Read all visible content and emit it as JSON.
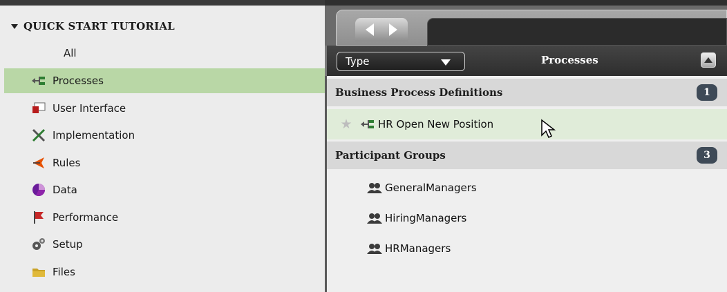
{
  "library": {
    "header": "QUICK START TUTORIAL",
    "items": [
      {
        "label": "All",
        "icon": "none",
        "selected": false
      },
      {
        "label": "Processes",
        "icon": "process-icon",
        "selected": true
      },
      {
        "label": "User Interface",
        "icon": "user-interface-icon",
        "selected": false
      },
      {
        "label": "Implementation",
        "icon": "tools-icon",
        "selected": false
      },
      {
        "label": "Rules",
        "icon": "rules-icon",
        "selected": false
      },
      {
        "label": "Data",
        "icon": "data-icon",
        "selected": false
      },
      {
        "label": "Performance",
        "icon": "flag-icon",
        "selected": false
      },
      {
        "label": "Setup",
        "icon": "gears-icon",
        "selected": false
      },
      {
        "label": "Files",
        "icon": "folder-icon",
        "selected": false
      }
    ]
  },
  "panel": {
    "type_select": "Type",
    "title": "Processes",
    "groups": [
      {
        "label": "Business Process Definitions",
        "count": "1",
        "items": [
          {
            "label": "HR Open New Position"
          }
        ]
      },
      {
        "label": "Participant Groups",
        "count": "3",
        "items": [
          {
            "label": "GeneralManagers"
          },
          {
            "label": "HiringManagers"
          },
          {
            "label": "HRManagers"
          }
        ]
      }
    ]
  }
}
